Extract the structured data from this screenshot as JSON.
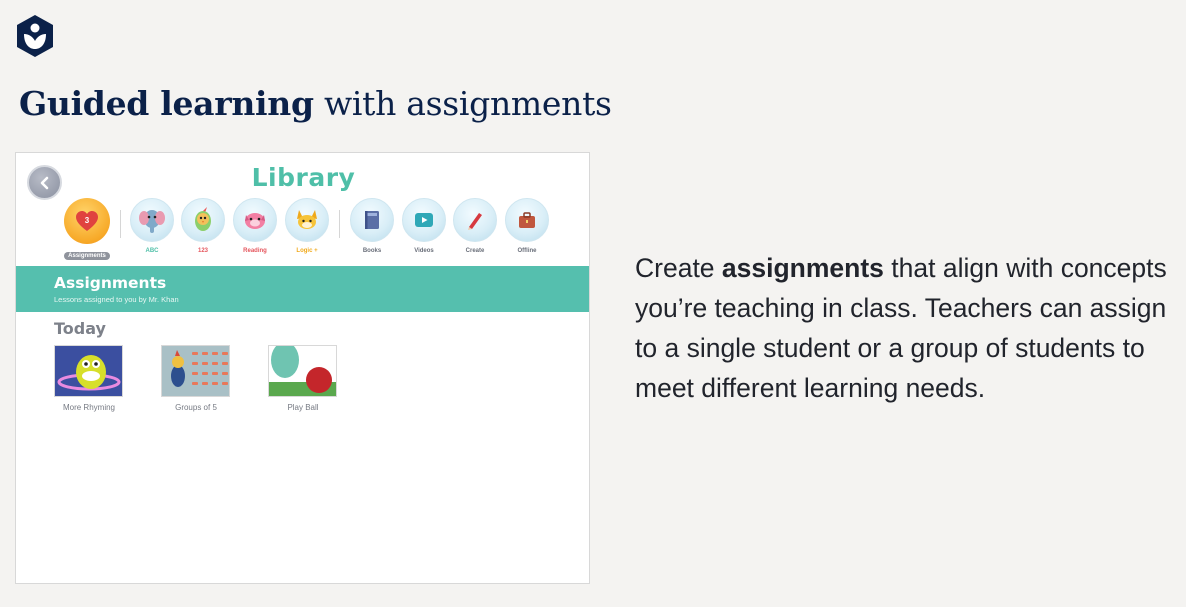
{
  "brand": {
    "logo_icon": "khan-academy-logo-icon",
    "color": "#0b2149"
  },
  "heading": {
    "bold": "Guided learning",
    "rest": " with assignments"
  },
  "app": {
    "title": "Library",
    "back_icon": "chevron-left-icon",
    "assignments_count": "3",
    "assignments_label": "Assignments",
    "categories": [
      {
        "label": "ABC",
        "color": "#4fbfa8",
        "icon": "elephant-icon"
      },
      {
        "label": "123",
        "color": "#e5565d",
        "icon": "bird-icon"
      },
      {
        "label": "Reading",
        "color": "#e5565d",
        "icon": "dog-icon"
      },
      {
        "label": "Logic +",
        "color": "#f0a91a",
        "icon": "fox-icon"
      },
      {
        "label": "Books",
        "color": "#6a6f7a",
        "icon": "book-icon"
      },
      {
        "label": "Videos",
        "color": "#6a6f7a",
        "icon": "play-icon"
      },
      {
        "label": "Create",
        "color": "#6a6f7a",
        "icon": "crayon-icon"
      },
      {
        "label": "Offline",
        "color": "#6a6f7a",
        "icon": "suitcase-icon"
      }
    ],
    "banner": {
      "title": "Assignments",
      "subtitle": "Lessons assigned to you by Mr. Khan"
    },
    "section_title": "Today",
    "lessons": [
      {
        "caption": "More Rhyming"
      },
      {
        "caption": "Groups of 5"
      },
      {
        "caption": "Play Ball"
      }
    ]
  },
  "description": {
    "part1": "Create ",
    "bold": "assignments",
    "part2": " that align with concepts you’re teaching in class. Teachers can assign to a single student or a group of students to meet different learning needs."
  },
  "colors": {
    "accent": "#55bfae",
    "title": "#4fbfa8",
    "background": "#f4f3f1"
  }
}
